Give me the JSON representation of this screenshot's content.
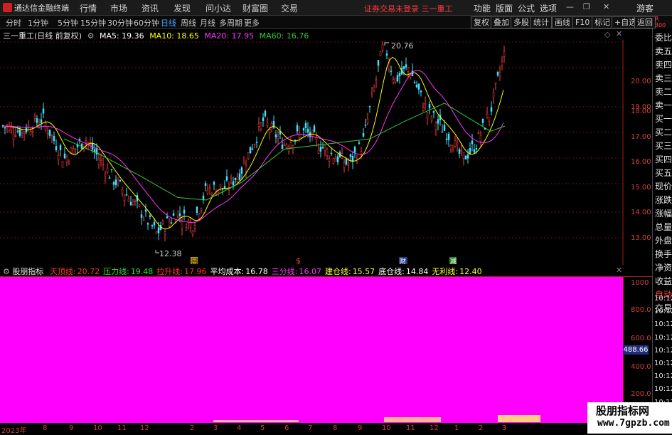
{
  "app": {
    "title": "通达信金融终端",
    "menu": [
      "行情",
      "市场",
      "资讯",
      "发现",
      "问小达",
      "财富圈",
      "交易"
    ],
    "login_status": "证券交易未登录 三一重工",
    "right_menu": [
      "功能",
      "版面",
      "公式",
      "选项"
    ],
    "user": "游客"
  },
  "periods": {
    "items": [
      "分时",
      "1分钟",
      "5分钟",
      "15分钟",
      "30分钟",
      "60分钟",
      "日线",
      "周线",
      "月线",
      "多周期",
      "更多"
    ],
    "active": "日线"
  },
  "toolbar_buttons": [
    "复权",
    "叠加",
    "多股",
    "统计",
    "画线",
    "F10",
    "标记",
    "+自选",
    "返回"
  ],
  "chart": {
    "stock_title": "三一重工(日线 前复权)",
    "ma_labels": [
      "MA5: 19.36",
      "MA10: 18.65",
      "MA20: 17.95",
      "MA60: 16.76"
    ],
    "ma_colors": [
      "#ffffff",
      "#ffff00",
      "#ff33ff",
      "#33cc33"
    ],
    "high_annotation": "20.76",
    "low_annotation": "12.38",
    "price_ticks": [
      "20.00",
      "19.00",
      "18.00",
      "17.00",
      "16.00",
      "15.00",
      "14.00",
      "13.00"
    ],
    "event_markers": [
      "回",
      "$",
      "财",
      "减"
    ]
  },
  "indicator": {
    "name": "股朋指标",
    "lines": [
      {
        "label": "天顶线:",
        "value": "20.72",
        "color": "#ff3333"
      },
      {
        "label": "压力线:",
        "value": "19.48",
        "color": "#33dd33"
      },
      {
        "label": "拉升线:",
        "value": "17.96",
        "color": "#ff3333"
      },
      {
        "label": "平均成本:",
        "value": "16.78",
        "color": "#ffffff"
      },
      {
        "label": "三分线:",
        "value": "16.07",
        "color": "#ff33ff"
      },
      {
        "label": "建仓线:",
        "value": "15.57",
        "color": "#ffff33"
      },
      {
        "label": "底仓线:",
        "value": "14.84",
        "color": "#ffffff"
      },
      {
        "label": "无利线:",
        "value": "12.40",
        "color": "#ffff33"
      }
    ],
    "value_ticks": [
      "1000",
      "800.0",
      "600.0",
      "400.0",
      "200.0"
    ],
    "current_value": "488.66"
  },
  "dates": [
    "2023年",
    "8",
    "9",
    "10",
    "11",
    "12",
    "2",
    "3",
    "4",
    "5",
    "6",
    "7",
    "8",
    "9",
    "10",
    "11",
    "12",
    "1",
    "2",
    "3"
  ],
  "side_panel": {
    "top": "R\n300",
    "items": [
      "委比",
      "卖五",
      "卖四",
      "卖三",
      "卖二",
      "卖一",
      "买一",
      "买二",
      "买三",
      "买四",
      "买五",
      "现价",
      "涨跌",
      "涨幅",
      "总量",
      "外盘",
      "换手",
      "净资",
      "收益",
      "自动",
      "交易",
      "10:12",
      "10:12",
      "10:12",
      "10:12",
      "10:12",
      "10:12",
      "10:12",
      "10:12",
      "10:12",
      "10:12"
    ]
  },
  "watermark": {
    "title": "股朋指标网",
    "url": "www.7gpzb.com"
  }
}
